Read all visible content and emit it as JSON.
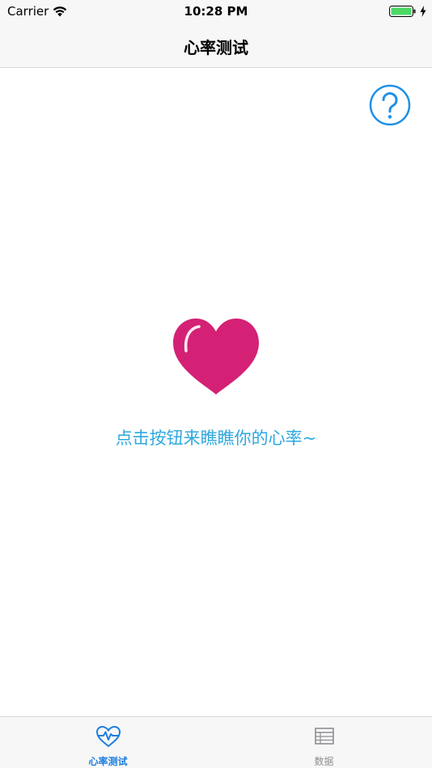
{
  "status_bar": {
    "carrier": "Carrier",
    "time": "10:28 PM",
    "wifi_icon": "wifi-icon",
    "battery_icon": "battery-icon",
    "charge_icon": "charging-bolt-icon"
  },
  "nav": {
    "title": "心率测试"
  },
  "help": {
    "icon": "question-circle-icon",
    "color": "#1e90e6"
  },
  "heart": {
    "icon": "heart-icon",
    "color": "#d42176"
  },
  "prompt": {
    "text": "点击按钮来瞧瞧你的心率~",
    "color": "#2ea8e0"
  },
  "tabs": [
    {
      "label": "心率测试",
      "icon": "heart-pulse-icon",
      "active": true,
      "color": "#1f7fe0"
    },
    {
      "label": "数据",
      "icon": "table-icon",
      "active": false,
      "color": "#8e8e93"
    }
  ]
}
